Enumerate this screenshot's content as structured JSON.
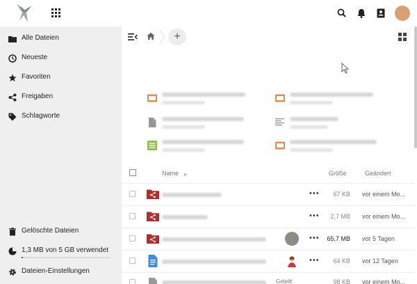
{
  "colors": {
    "sidebar_bg": "#efefef",
    "folder_shared_red": "#b22e2e",
    "presentation_orange": "#e9894a",
    "spreadsheet_green": "#8bc34a",
    "document_blue": "#3d8be0",
    "avatar_tan": "#d9a173"
  },
  "header": {
    "icons": [
      "app-logo",
      "apps-grid-icon",
      "search-icon",
      "notifications-bell-icon",
      "contacts-icon",
      "user-avatar"
    ]
  },
  "sidebar": {
    "items": [
      {
        "label": "Alle Dateien",
        "icon": "folder-icon"
      },
      {
        "label": "Neueste",
        "icon": "clock-icon"
      },
      {
        "label": "Favoriten",
        "icon": "star-icon"
      },
      {
        "label": "Freigaben",
        "icon": "share-icon"
      },
      {
        "label": "Schlagworte",
        "icon": "tag-icon"
      }
    ],
    "bottom": {
      "trash": {
        "label": "Gelöschte Dateien",
        "icon": "trash-icon"
      },
      "quota": {
        "label": "1,3 MB von 5 GB verwendet",
        "icon": "pie-chart-icon",
        "used_fraction": 0.0003
      },
      "settings": {
        "label": "Dateien-Einstellungen",
        "icon": "gear-icon"
      }
    }
  },
  "toolbar": {
    "icons": [
      "collapse-navigation-icon",
      "home-icon",
      "add-icon",
      "grid-view-icon"
    ],
    "add_label": "+"
  },
  "recent": [
    {
      "icon": "presentation-icon"
    },
    {
      "icon": "presentation-icon"
    },
    {
      "icon": "file-icon"
    },
    {
      "icon": "text-file-icon"
    },
    {
      "icon": "spreadsheet-icon"
    },
    {
      "icon": "presentation-icon"
    }
  ],
  "table": {
    "headers": {
      "name": "Name",
      "sort_indicator": "▲",
      "size": "Größe",
      "modified": "Geändert"
    },
    "rows": [
      {
        "icon": "shared-folder-icon",
        "size": "67 KB",
        "modified": "vor einem Mo...",
        "menu": "•••"
      },
      {
        "icon": "shared-folder-icon",
        "size": "2,7 MB",
        "modified": "vor einem Mo...",
        "menu": "•••"
      },
      {
        "icon": "shared-folder-icon",
        "size": "65,7 MB",
        "modified": "vor 5 Tagen",
        "menu": "•••"
      },
      {
        "icon": "document-icon",
        "size": "64 KB",
        "modified": "vor 12 Tagen",
        "menu": "•••"
      },
      {
        "icon": "file-icon",
        "size": "98 KB",
        "modified": "vor einem Mo...",
        "menu": "",
        "shared_label": "Geteilt"
      }
    ]
  }
}
